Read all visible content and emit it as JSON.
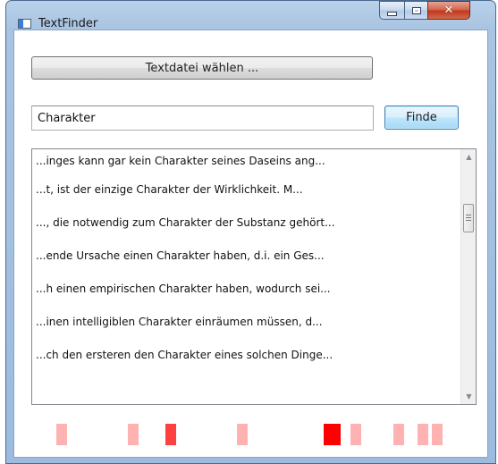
{
  "window": {
    "title": "TextFinder"
  },
  "toolbar": {
    "choose_file_label": "Textdatei wählen ..."
  },
  "search": {
    "value": "Charakter",
    "button_label": "Finde"
  },
  "results": [
    "...inges kann gar kein Charakter seines Daseins ang...",
    "...t, ist der einzige Charakter der Wirklichkeit. M...",
    "..., die notwendig zum Charakter der Substanz gehört...",
    "...ende Ursache einen Charakter haben, d.i. ein Ges...",
    "...h einen empirischen Charakter haben, wodurch sei...",
    "...inen intelligiblen Charakter einräumen müssen, d...",
    "...ch den ersteren den Charakter eines solchen Dinge..."
  ],
  "scrollbar": {
    "position": 0.2
  },
  "hit_markers": [
    {
      "position": 0.1,
      "intensity": 0.3
    },
    {
      "position": 0.25,
      "intensity": 0.3
    },
    {
      "position": 0.33,
      "intensity": 0.75
    },
    {
      "position": 0.48,
      "intensity": 0.3
    },
    {
      "position": 0.67,
      "intensity": 1.0
    },
    {
      "position": 0.72,
      "intensity": 0.3
    },
    {
      "position": 0.81,
      "intensity": 0.3
    },
    {
      "position": 0.86,
      "intensity": 0.3
    },
    {
      "position": 0.89,
      "intensity": 0.3
    }
  ],
  "colors": {
    "accent": "#3c7fb1",
    "hit": "#ff0000"
  }
}
